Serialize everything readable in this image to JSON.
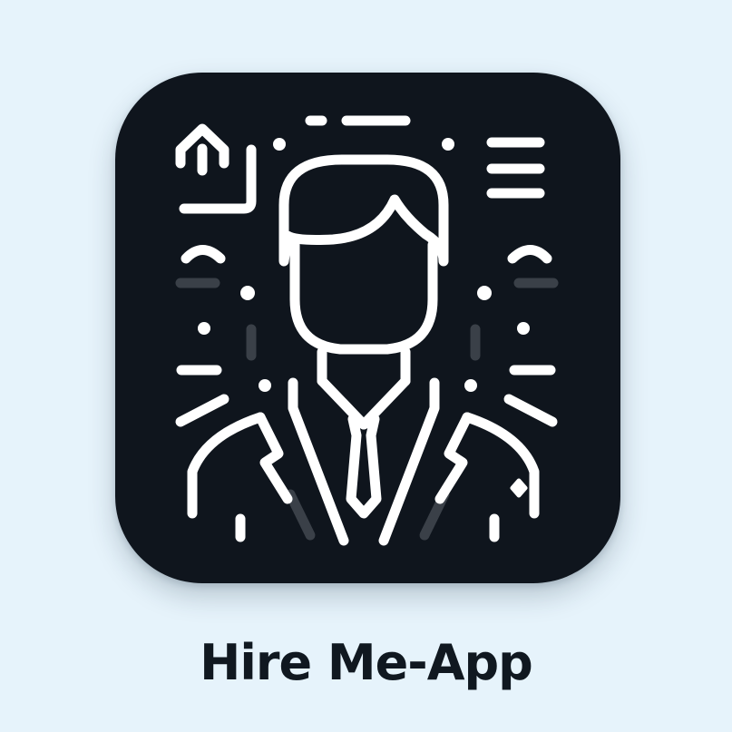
{
  "app": {
    "name": "Hire Me-App"
  },
  "icon": {
    "depicts": "person-in-suit-icon"
  },
  "colors": {
    "background": "#e6f3fb",
    "icon_tile": "#0f151d",
    "line_art": "#ffffff",
    "muted_line_art": "#3a4048",
    "title_text": "#101820"
  }
}
